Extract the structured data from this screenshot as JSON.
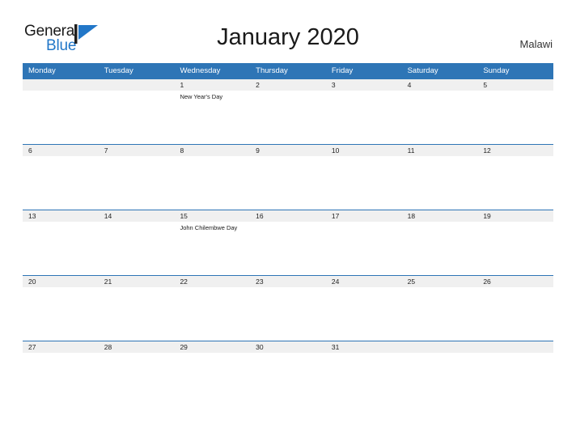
{
  "brand": {
    "name_part1": "General",
    "name_part2": "Blue",
    "flag_icon": "blue-pennant-icon",
    "colors": {
      "dark_text": "#1a1a1a",
      "brand_blue": "#2277c8",
      "header_blue": "#2e75b6",
      "row_band_gray": "#f0f0f0"
    }
  },
  "header": {
    "title": "January 2020",
    "region": "Malawi"
  },
  "calendar": {
    "weekdays": [
      "Monday",
      "Tuesday",
      "Wednesday",
      "Thursday",
      "Friday",
      "Saturday",
      "Sunday"
    ],
    "weeks": [
      {
        "dates": [
          "",
          "",
          "1",
          "2",
          "3",
          "4",
          "5"
        ],
        "events": [
          "",
          "",
          "New Year's Day",
          "",
          "",
          "",
          ""
        ]
      },
      {
        "dates": [
          "6",
          "7",
          "8",
          "9",
          "10",
          "11",
          "12"
        ],
        "events": [
          "",
          "",
          "",
          "",
          "",
          "",
          ""
        ]
      },
      {
        "dates": [
          "13",
          "14",
          "15",
          "16",
          "17",
          "18",
          "19"
        ],
        "events": [
          "",
          "",
          "John Chilembwe Day",
          "",
          "",
          "",
          ""
        ]
      },
      {
        "dates": [
          "20",
          "21",
          "22",
          "23",
          "24",
          "25",
          "26"
        ],
        "events": [
          "",
          "",
          "",
          "",
          "",
          "",
          ""
        ]
      },
      {
        "dates": [
          "27",
          "28",
          "29",
          "30",
          "31",
          "",
          ""
        ],
        "events": [
          "",
          "",
          "",
          "",
          "",
          "",
          ""
        ]
      }
    ]
  }
}
